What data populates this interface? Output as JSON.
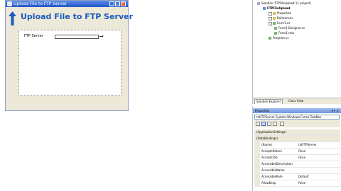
{
  "form": {
    "title": "Upload File to FTP Server",
    "heading": "Upload File to FTP Server",
    "ftp_label": "FTP Server"
  },
  "solution_explorer": {
    "items": [
      {
        "label": "Solution 'FTPFileUpload' (1 project)",
        "indent": 0,
        "icon": "solution-icon"
      },
      {
        "label": "FTPFileUpload",
        "indent": 1,
        "icon": "project-icon",
        "bold": true
      },
      {
        "label": "Properties",
        "indent": 2,
        "icon": "folder-icon"
      },
      {
        "label": "References",
        "indent": 2,
        "icon": "folder-icon"
      },
      {
        "label": "Form1.cs",
        "indent": 2,
        "icon": "form-icon"
      },
      {
        "label": "Form1.Designer.cs",
        "indent": 3,
        "icon": "cs-file-icon"
      },
      {
        "label": "Form1.resx",
        "indent": 3,
        "icon": "resx-file-icon"
      },
      {
        "label": "Program.cs",
        "indent": 2,
        "icon": "cs-file-icon"
      }
    ]
  },
  "tabs": {
    "solution_explorer": "Solution Explorer",
    "class_view": "Class View"
  },
  "properties": {
    "title": "Properties",
    "pin": "▾ ╕ ×",
    "object": "txtFTPServer System.Windows.Forms.TextBox",
    "rows": [
      {
        "type": "cat",
        "label": "(ApplicationSettings)"
      },
      {
        "type": "cat",
        "label": "(DataBindings)"
      },
      {
        "name": "(Name)",
        "value": "txtFTPServer"
      },
      {
        "name": "AcceptsReturn",
        "value": "False"
      },
      {
        "name": "AcceptsTab",
        "value": "False"
      },
      {
        "name": "AccessibleDescription",
        "value": ""
      },
      {
        "name": "AccessibleName",
        "value": ""
      },
      {
        "name": "AccessibleRole",
        "value": "Default"
      },
      {
        "name": "AllowDrop",
        "value": "False"
      }
    ]
  }
}
